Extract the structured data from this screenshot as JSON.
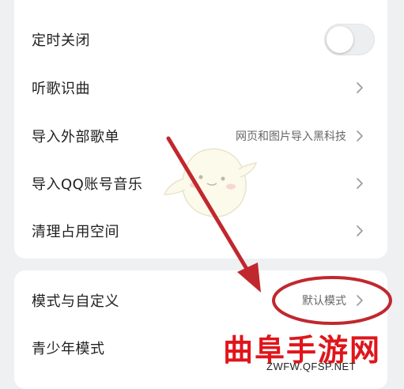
{
  "settings_group_1": {
    "items": [
      {
        "label": "定时关闭",
        "control": "toggle",
        "toggle_on": false
      },
      {
        "label": "听歌识曲",
        "control": "chevron"
      },
      {
        "label": "导入外部歌单",
        "value": "网页和图片导入黑科技",
        "control": "chevron"
      },
      {
        "label": "导入QQ账号音乐",
        "control": "chevron"
      },
      {
        "label": "清理占用空间",
        "control": "chevron"
      }
    ]
  },
  "settings_group_2": {
    "items": [
      {
        "label": "模式与自定义",
        "value": "默认模式",
        "control": "chevron"
      },
      {
        "label": "青少年模式",
        "control": "none"
      }
    ]
  },
  "annotation": {
    "arrow_color": "#c0282e",
    "circle_color": "#c0282e"
  },
  "watermark": {
    "text": "曲阜手游网",
    "url": "ZWFW.QFSP.NET",
    "color": "#e0151b"
  },
  "colors": {
    "background": "#eef0f2",
    "card": "#ffffff",
    "text": "#1f1f1f",
    "secondary": "#666666"
  }
}
